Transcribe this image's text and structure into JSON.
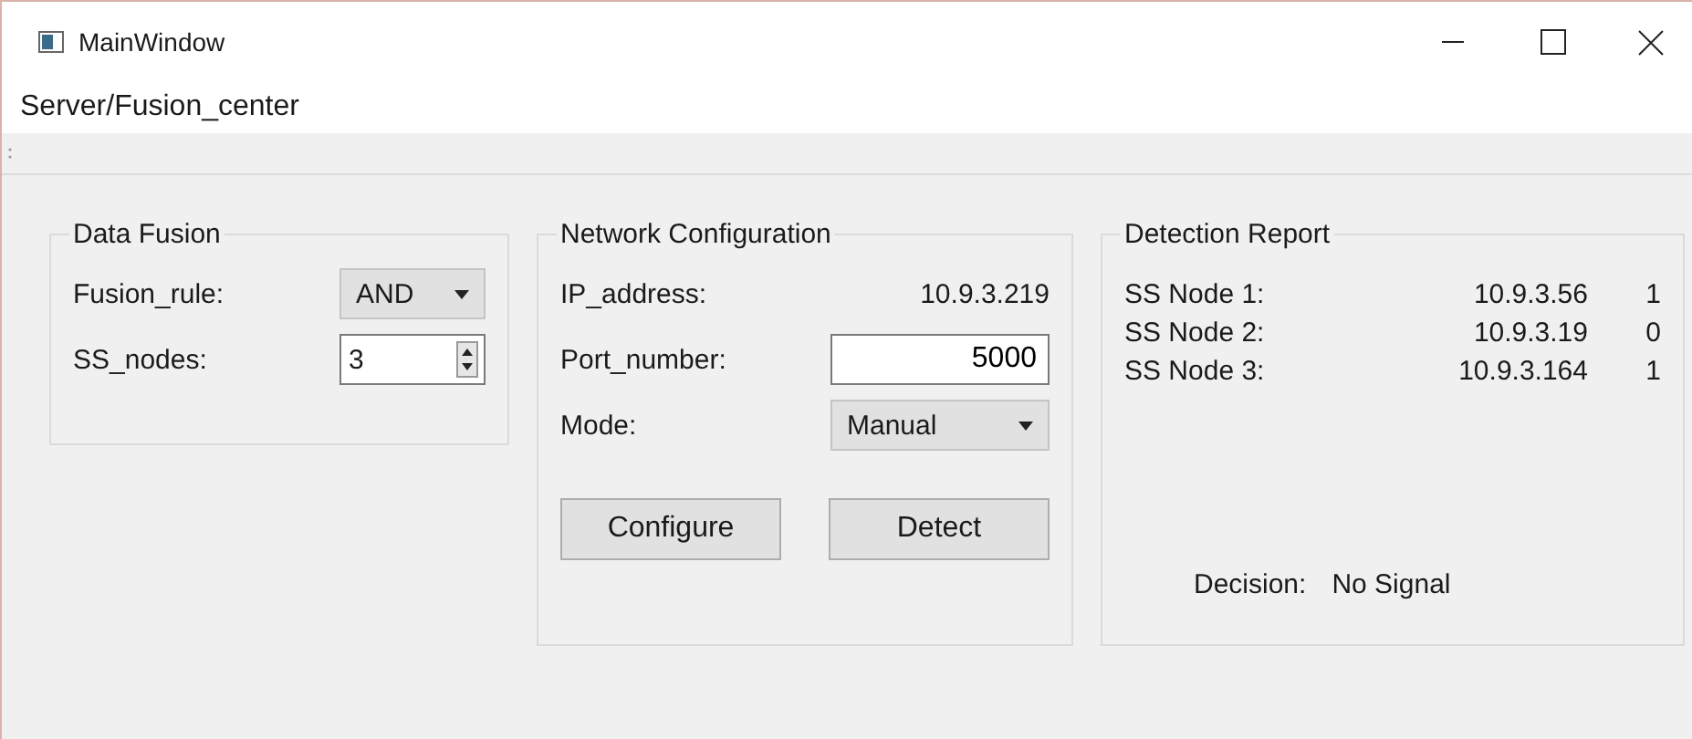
{
  "window": {
    "title": "MainWindow"
  },
  "menu": [
    "Server/Fusion_center"
  ],
  "data_fusion": {
    "title": "Data Fusion",
    "fusion_rule_label": "Fusion_rule:",
    "fusion_rule": "AND",
    "ss_nodes_label": "SS_nodes:",
    "ss_nodes": "3"
  },
  "network_configuration": {
    "title": "Network Configuration",
    "ip_label": "IP_address:",
    "ip": "10.9.3.219",
    "port_label": "Port_number:",
    "port": "5000",
    "mode_label": "Mode:",
    "mode": "Manual",
    "buttons": [
      "Configure",
      "Detect"
    ]
  },
  "detection_report": {
    "title": "Detection Report",
    "nodes": [
      {
        "label": "SS Node 1:",
        "ip": "10.9.3.56",
        "result": "1"
      },
      {
        "label": "SS Node 2:",
        "ip": "10.9.3.19",
        "result": "0"
      },
      {
        "label": "SS Node 3:",
        "ip": "10.9.3.164",
        "result": "1"
      }
    ],
    "decision_label": "Decision:",
    "decision": "No Signal"
  }
}
